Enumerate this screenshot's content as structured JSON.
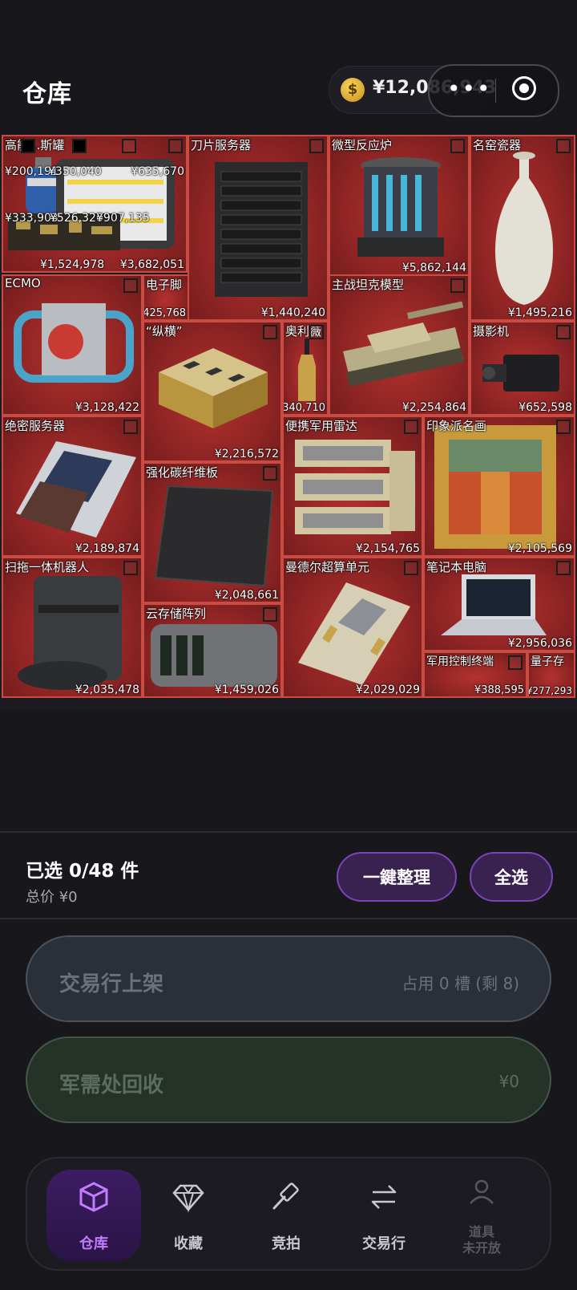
{
  "header": {
    "title": "仓库",
    "coin_symbol": "$",
    "balance": "¥12,086,943"
  },
  "items": [
    {
      "name": "高能...斯罐",
      "price": "¥635,670"
    },
    {
      "name": "",
      "price": "¥3,682,051"
    },
    {
      "name": "刀片服务器",
      "price": "¥1,440,240"
    },
    {
      "name": "微型反应炉",
      "price": "¥5,862,144"
    },
    {
      "name": "名窑瓷器",
      "price": "¥1,495,216"
    },
    {
      "name": "ECMO",
      "price": "¥3,128,422"
    },
    {
      "name": "电子脚",
      "price": "¥425,768"
    },
    {
      "name": "“纵横”",
      "price": "¥2,216,572"
    },
    {
      "name": "奥利薇",
      "price": "¥340,710"
    },
    {
      "name": "主战坦克模型",
      "price": "¥2,254,864"
    },
    {
      "name": "摄影机",
      "price": "¥652,598"
    },
    {
      "name": "绝密服务器",
      "price": "¥2,189,874"
    },
    {
      "name": "强化碳纤维板",
      "price": "¥2,048,661"
    },
    {
      "name": "便携军用雷达",
      "price": "¥2,154,765"
    },
    {
      "name": "印象派名画",
      "price": "¥2,105,569"
    },
    {
      "name": "扫拖一体机器人",
      "price": "¥2,035,478"
    },
    {
      "name": "云存储阵列",
      "price": "¥1,459,026"
    },
    {
      "name": "曼德尔超算单元",
      "price": "¥2,029,029"
    },
    {
      "name": "笔记本电脑",
      "price": "¥2,956,036"
    },
    {
      "name": "军用控制终端",
      "price": "¥388,595"
    },
    {
      "name": "量子存",
      "price": "¥277,293"
    }
  ],
  "small_items": [
    {
      "price": "¥200,191"
    },
    {
      "price": "¥350,040"
    },
    {
      "price": "¥333,903"
    },
    {
      "price": "¥526,320"
    },
    {
      "price": "¥907,135"
    },
    {
      "price": "¥1,524,978"
    }
  ],
  "summary": {
    "selected": "已选 0/48 件",
    "total": "总价  ¥0",
    "organize_label": "一鍵整理",
    "select_all_label": "全选"
  },
  "actions": {
    "trade_label": "交易行上架",
    "trade_info": "占用 0 槽 (剩 8)",
    "recycle_label": "军需处回收",
    "recycle_value": "¥0"
  },
  "nav": [
    {
      "label": "仓库",
      "icon": "box-icon",
      "active": true
    },
    {
      "label": "收藏",
      "icon": "diamond-icon"
    },
    {
      "label": "竞拍",
      "icon": "gavel-icon"
    },
    {
      "label": "交易行",
      "icon": "swap-arrows-icon"
    },
    {
      "label": "道具\n未开放",
      "icon": "person-icon",
      "disabled": true
    }
  ],
  "colors": {
    "accent": "#7b45b8",
    "tile": "#8e2424"
  }
}
